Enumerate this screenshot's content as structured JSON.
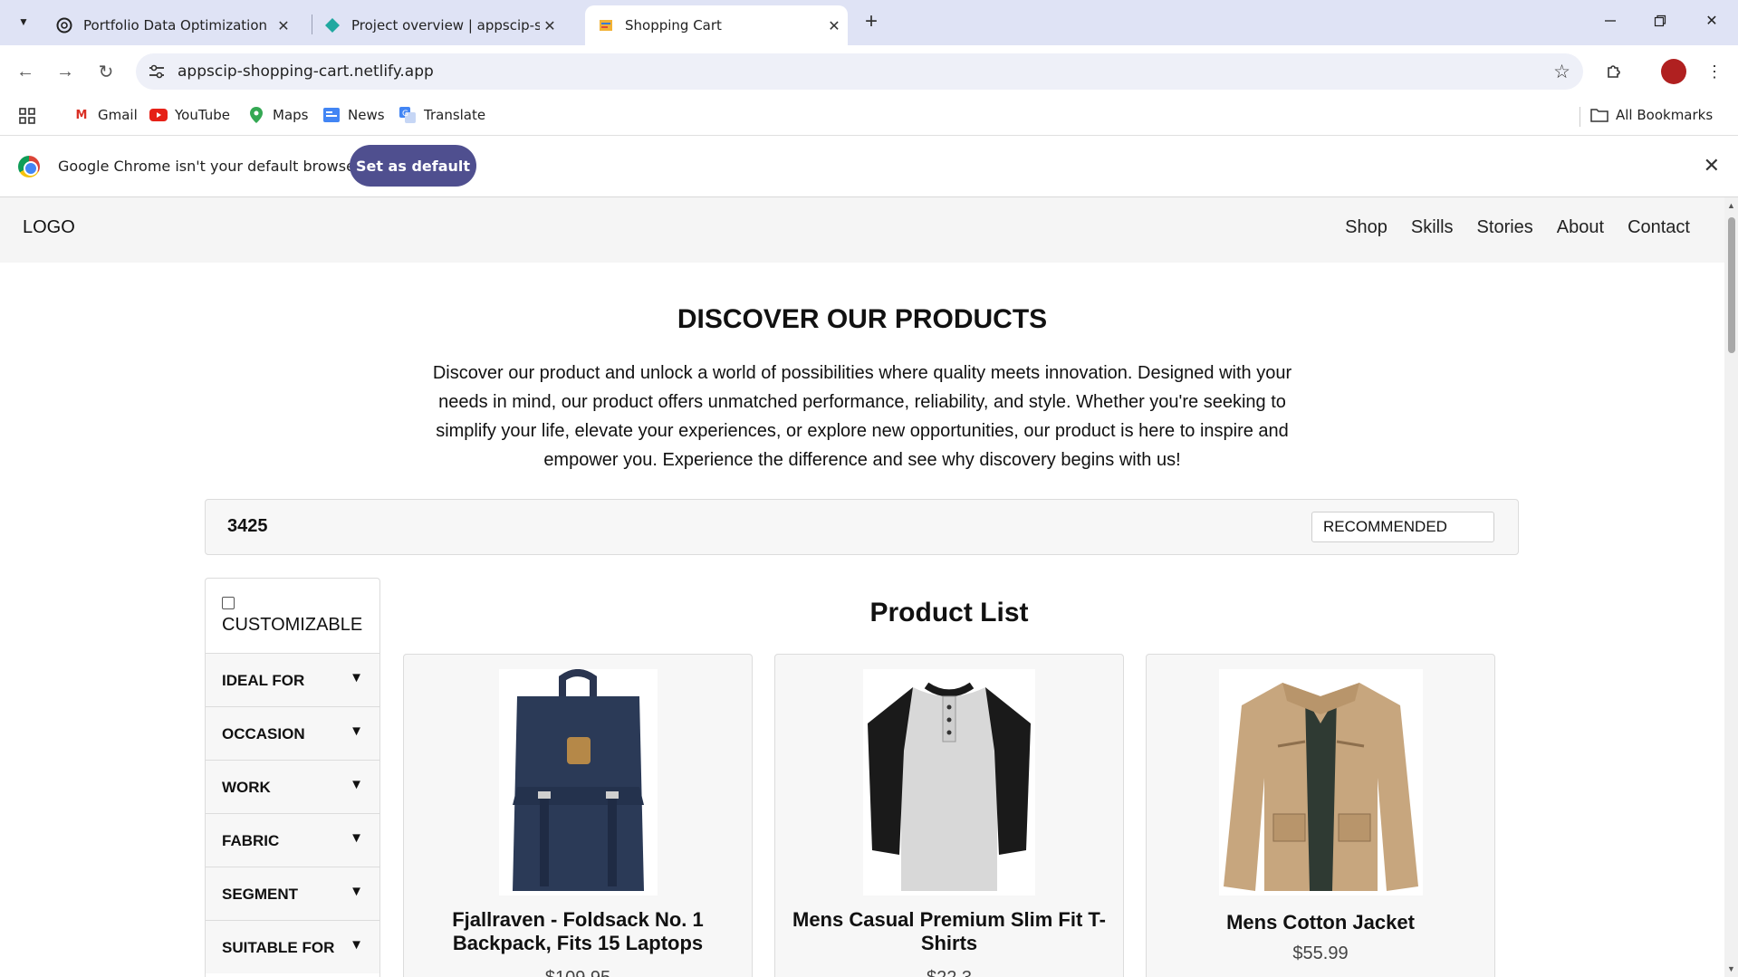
{
  "browser": {
    "tabs": [
      {
        "title": "Portfolio Data Optimization",
        "active": false
      },
      {
        "title": "Project overview | appscip-shop",
        "active": false
      },
      {
        "title": "Shopping Cart",
        "active": true
      }
    ],
    "url": "appscip-shopping-cart.netlify.app",
    "bookmarks": [
      "Gmail",
      "YouTube",
      "Maps",
      "News",
      "Translate"
    ],
    "all_bookmarks": "All Bookmarks",
    "infobar": {
      "message": "Google Chrome isn't your default browser",
      "button": "Set as default"
    }
  },
  "site": {
    "logo": "LOGO",
    "nav": [
      "Shop",
      "Skills",
      "Stories",
      "About",
      "Contact"
    ],
    "heading": "DISCOVER OUR PRODUCTS",
    "intro": "Discover our product and unlock a world of possibilities where quality meets innovation. Designed with your needs in mind, our product offers unmatched performance, reliability, and style. Whether you're seeking to simplify your life, elevate your experiences, or explore new opportunities, our product is here to inspire and empower you. Experience the difference and see why discovery begins with us!",
    "item_count": "3425",
    "sort_value": "RECOMMENDED",
    "filters": {
      "customizable_label": "CUSTOMIZABLE",
      "facets": [
        "IDEAL FOR",
        "OCCASION",
        "WORK",
        "FABRIC",
        "SEGMENT",
        "SUITABLE FOR"
      ]
    },
    "product_list_title": "Product List",
    "products": [
      {
        "name": "Fjallraven - Foldsack No. 1 Backpack, Fits 15 Laptops",
        "price": "$109.95"
      },
      {
        "name": "Mens Casual Premium Slim Fit T-Shirts",
        "price": "$22.3"
      },
      {
        "name": "Mens Cotton Jacket",
        "price": "$55.99"
      }
    ]
  },
  "colors": {
    "tab_strip": "#dfe3f5",
    "accent_button": "#4f4f8f"
  }
}
